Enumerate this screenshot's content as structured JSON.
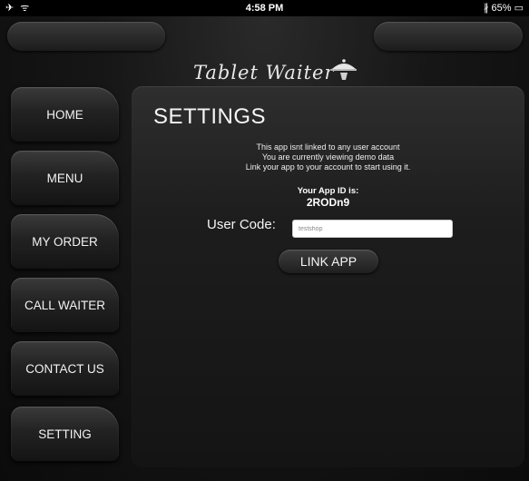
{
  "status_bar": {
    "left_icons": "✈ ᯤ",
    "time": "4:58 PM",
    "right": "∦ 65% ▭"
  },
  "brand": {
    "name": "Tablet Waiter",
    "logo_icon": "cloche-icon"
  },
  "nav": {
    "items": [
      {
        "label": "HOME"
      },
      {
        "label": "MENU"
      },
      {
        "label": "MY ORDER"
      },
      {
        "label": "CALL WAITER"
      },
      {
        "label": "CONTACT US"
      },
      {
        "label": "SETTING"
      }
    ]
  },
  "settings": {
    "title": "SETTINGS",
    "info_lines": [
      "This app isnt linked to any user account",
      "You are currently viewing demo data",
      "Link your app to your account to start using it."
    ],
    "app_id_label": "Your App ID is:",
    "app_id_value": "2RODn9",
    "user_code_label": "User Code:",
    "user_code_value": "testshop",
    "link_button": "LINK APP"
  }
}
